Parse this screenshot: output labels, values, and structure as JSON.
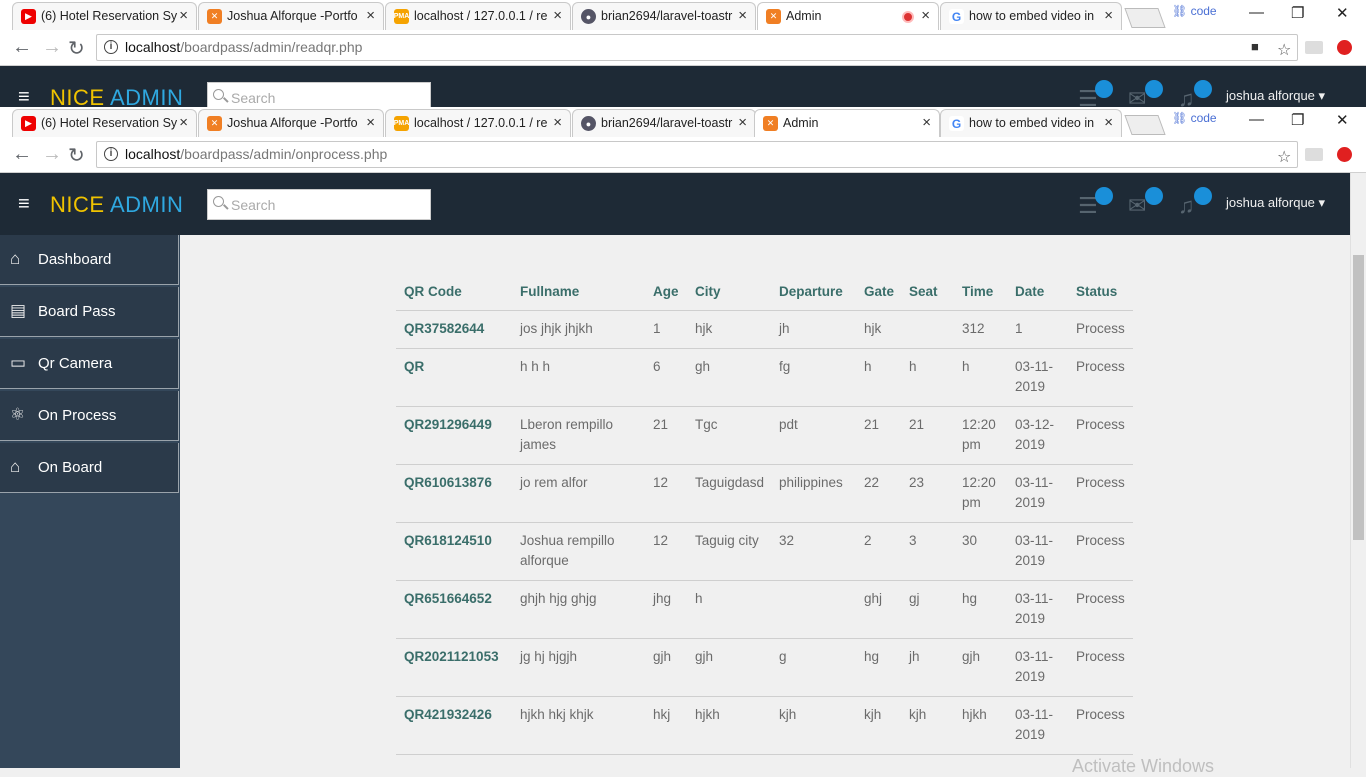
{
  "browser_back": {
    "tabs": [
      "(6) Hotel Reservation Sy",
      "Joshua Alforque -Portfo",
      "localhost / 127.0.0.1 / re",
      "brian2694/laravel-toastr",
      "Admin",
      "how to embed video in"
    ],
    "profile": "code",
    "url_host": "localhost",
    "url_path": "/boardpass/admin/readqr.php"
  },
  "browser_front": {
    "tabs": [
      "(6) Hotel Reservation Sy",
      "Joshua Alforque -Portfo",
      "localhost / 127.0.0.1 / re",
      "brian2694/laravel-toastr",
      "Admin",
      "how to embed video in"
    ],
    "profile": "code",
    "url_host": "localhost",
    "url_path": "/boardpass/admin/onprocess.php"
  },
  "app": {
    "brand_nice": "NICE",
    "brand_admin": "ADMIN",
    "search_placeholder": "Search",
    "user": "joshua alforque"
  },
  "sidebar": {
    "items": [
      {
        "label": "Dashboard",
        "icon": "home-icon"
      },
      {
        "label": "Board Pass",
        "icon": "clipboard-icon"
      },
      {
        "label": "Qr Camera",
        "icon": "monitor-icon"
      },
      {
        "label": "On Process",
        "icon": "atom-icon"
      },
      {
        "label": "On Board",
        "icon": "home-icon"
      }
    ]
  },
  "table": {
    "headers": [
      "QR Code",
      "Fullname",
      "Age",
      "City",
      "Departure",
      "Gate",
      "Seat",
      "Time",
      "Date",
      "Status"
    ],
    "rows": [
      [
        "QR37582644",
        "jos jhjk jhjkh",
        "1",
        "hjk",
        "jh",
        "hjk",
        "",
        "312",
        "1",
        "Process"
      ],
      [
        "QR",
        "h h h",
        "6",
        "gh",
        "fg",
        "h",
        "h",
        "h",
        "03-11-\n2019",
        "Process"
      ],
      [
        "QR291296449",
        "Lberon rempillo\njames",
        "21",
        "Tgc",
        "pdt",
        "21",
        "21",
        "12:20\npm",
        "03-12-\n2019",
        "Process"
      ],
      [
        "QR610613876",
        "jo rem alfor",
        "12",
        "Taguigdasd",
        "philippines",
        "22",
        "23",
        "12:20\npm",
        "03-11-\n2019",
        "Process"
      ],
      [
        "QR618124510",
        "Joshua rempillo\nalforque",
        "12",
        "Taguig city",
        "32",
        "2",
        "3",
        "30",
        "03-11-\n2019",
        "Process"
      ],
      [
        "QR651664652",
        "ghjh hjg ghjg",
        "jhg",
        "h",
        "",
        "ghj",
        "gj",
        "hg",
        "03-11-\n2019",
        "Process"
      ],
      [
        "QR2021121053",
        "jg hj hjgjh",
        "gjh",
        "gjh",
        "g",
        "hg",
        "jh",
        "gjh",
        "03-11-\n2019",
        "Process"
      ],
      [
        "QR421932426",
        "hjkh hkj khjk",
        "hkj",
        "hjkh",
        "kjh",
        "kjh",
        "kjh",
        "hjkh",
        "03-11-\n2019",
        "Process"
      ]
    ]
  },
  "watermark": "Activate Windows",
  "colors": {
    "header_bg": "#1e2a36",
    "sidebar_bg": "#2b3a4a",
    "accent_teal": "#3a6e6a",
    "brand_yellow": "#f0c300",
    "brand_blue": "#2fa8e0",
    "badge_blue": "#1a8fd9"
  }
}
